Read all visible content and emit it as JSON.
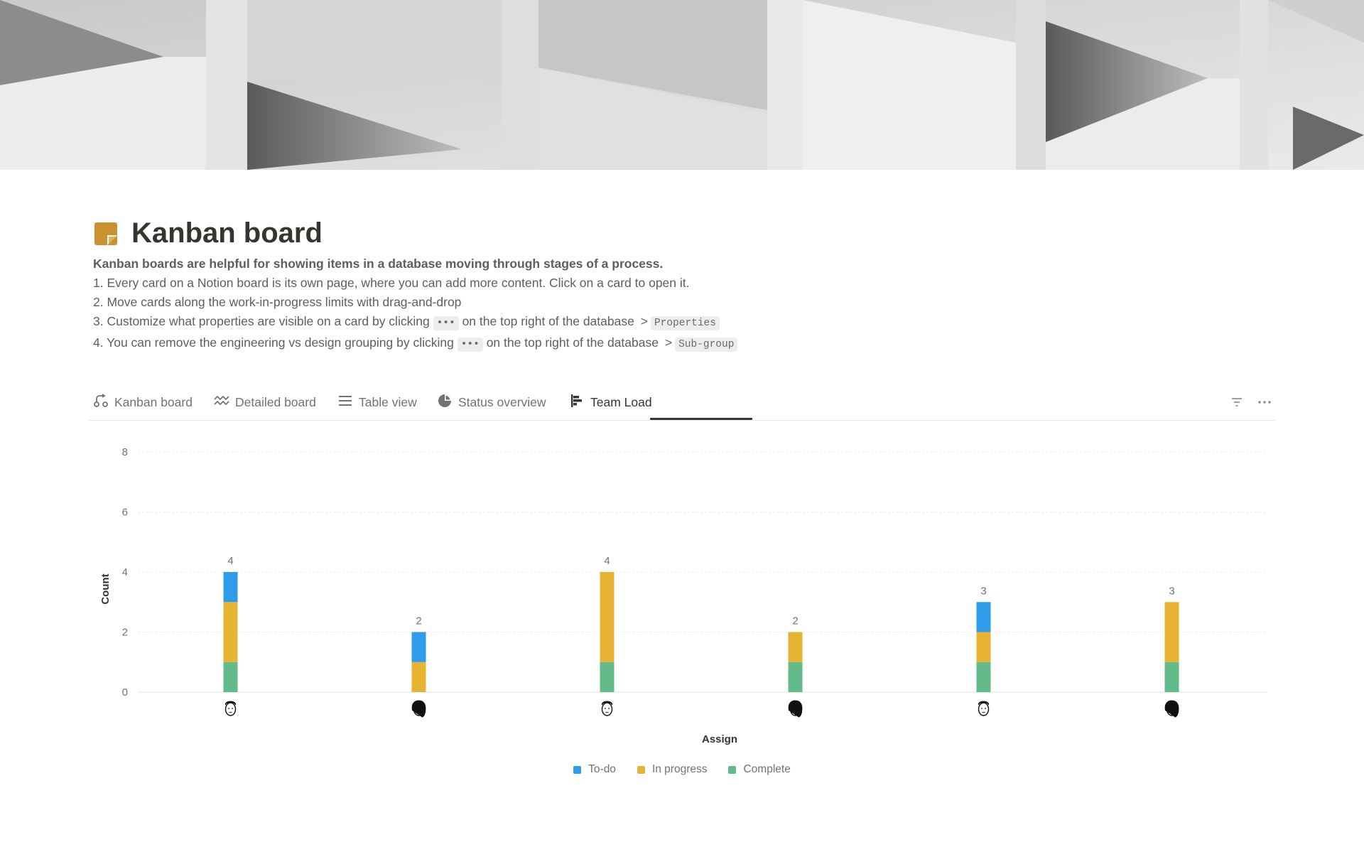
{
  "page": {
    "title": "Kanban board",
    "intro_bold": "Kanban boards are helpful for showing items in a database moving through stages of a process.",
    "line1": "1. Every card on a Notion board is its own page, where you can add more content. Click on a card to open it.",
    "line2": "2. Move cards along the work-in-progress limits with drag-and-drop",
    "line3_a": "3. Customize what properties are visible on a card by clicking",
    "line3_code1": "•••",
    "line3_b": "on the top right of the database",
    "line3_gt": ">",
    "line3_code2": "Properties",
    "line4_a": "4. You can remove the engineering vs design grouping by clicking",
    "line4_code1": "•••",
    "line4_b": "on the top right of the database",
    "line4_gt": ">",
    "line4_code2": "Sub-group"
  },
  "tabs": [
    {
      "label": "Kanban board",
      "icon": "kanban-icon"
    },
    {
      "label": "Detailed board",
      "icon": "wave-icon"
    },
    {
      "label": "Table view",
      "icon": "list-icon"
    },
    {
      "label": "Status overview",
      "icon": "pie-icon"
    },
    {
      "label": "Team Load",
      "icon": "bar-chart-icon",
      "active": true
    }
  ],
  "toolbar": {
    "filter_icon": "filter-icon",
    "more_icon": "more-icon"
  },
  "colors": {
    "todo": "#2f9ce9",
    "in_progress": "#e6b432",
    "complete": "#63bb8a",
    "accent": "#c7922f"
  },
  "chart_data": {
    "type": "bar",
    "stacked": true,
    "xlabel": "Assign",
    "ylabel": "Count",
    "ylim": [
      0,
      8
    ],
    "yticks": [
      0,
      2,
      4,
      6,
      8
    ],
    "grid": true,
    "legend": "bottom-center",
    "categories": [
      "person-1",
      "person-2",
      "person-3",
      "person-4",
      "person-5",
      "person-6"
    ],
    "category_icons": [
      "avatar-icon",
      "avatar-icon",
      "avatar-icon",
      "avatar-icon",
      "avatar-icon",
      "avatar-icon"
    ],
    "series": [
      {
        "name": "Complete",
        "values": [
          1,
          0,
          1,
          1,
          1,
          1
        ]
      },
      {
        "name": "In progress",
        "values": [
          2,
          1,
          3,
          1,
          1,
          2
        ]
      },
      {
        "name": "To-do",
        "values": [
          1,
          1,
          0,
          0,
          1,
          0
        ]
      }
    ],
    "totals": [
      4,
      2,
      4,
      2,
      3,
      3
    ]
  }
}
